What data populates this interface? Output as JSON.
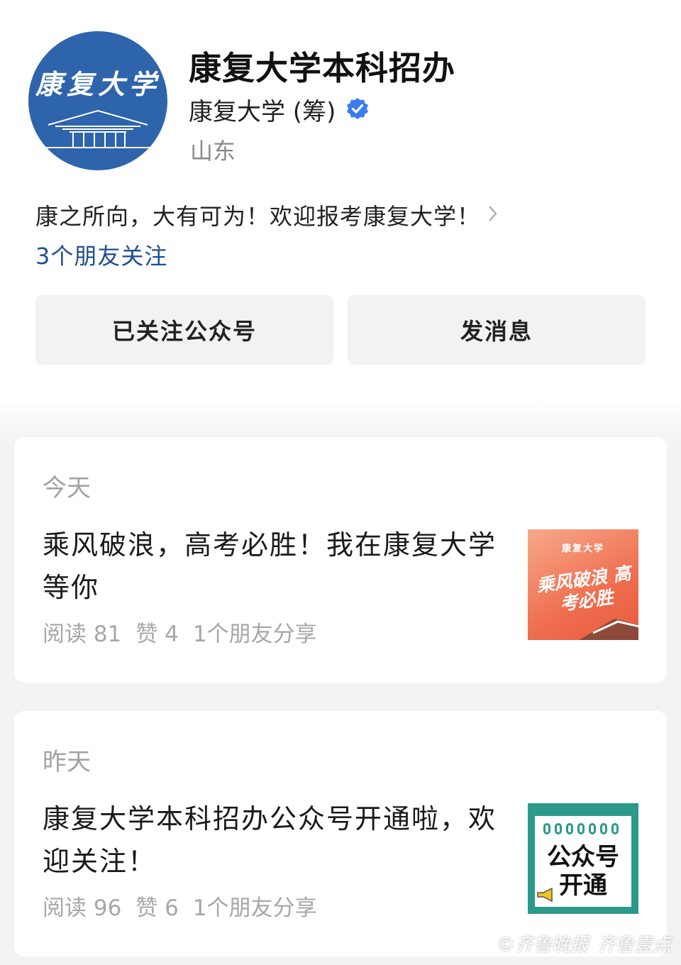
{
  "account": {
    "avatar_text": "康复大学",
    "name": "康复大学本科招办",
    "org": "康复大学 (筹)",
    "region": "山东",
    "bio": "康之所向，大有可为！欢迎报考康复大学！",
    "followers": "3个朋友关注"
  },
  "buttons": {
    "followed": "已关注公众号",
    "message": "发消息"
  },
  "articles": [
    {
      "day": "今天",
      "title": "乘风破浪，高考必胜！我在康复大学等你",
      "reads": "阅读 81",
      "likes": "赞 4",
      "shares": "1个朋友分享",
      "thumb_top": "康复大学",
      "thumb_main": "乘风破浪 高考必胜"
    },
    {
      "day": "昨天",
      "title": "康复大学本科招办公众号开通啦，欢迎关注！",
      "reads": "阅读 96",
      "likes": "赞 6",
      "shares": "1个朋友分享",
      "thumb_main": "公众号 开通"
    }
  ],
  "watermark": {
    "left": "©齐鲁晚报",
    "right": "齐鲁壹点"
  },
  "colors": {
    "avatar_blue": "#2e64ac",
    "link_blue": "#1e4f91",
    "verified_blue": "#3a7bf2"
  }
}
